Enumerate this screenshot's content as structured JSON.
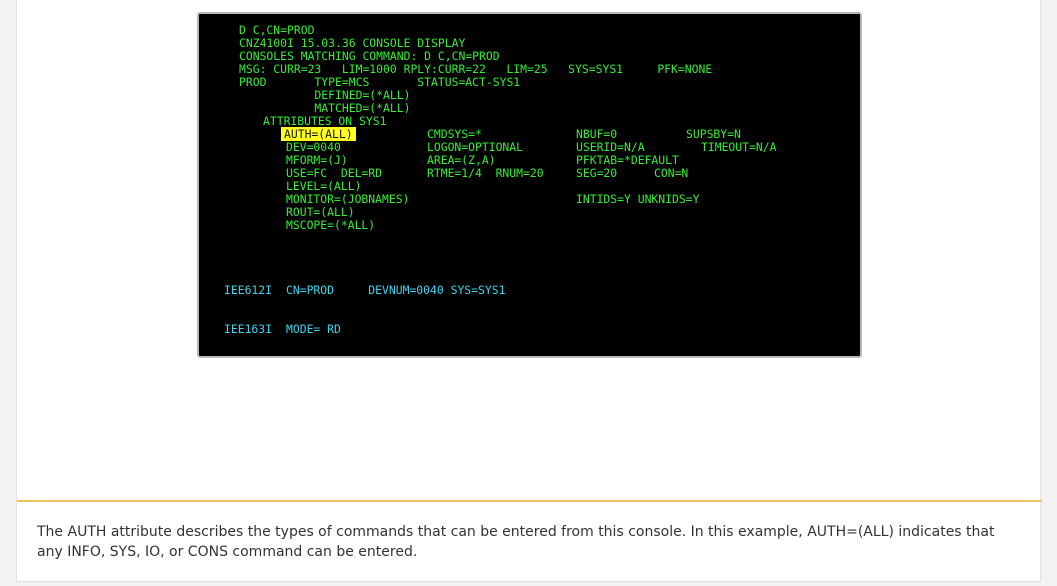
{
  "terminal": {
    "header": [
      "D C,CN=PROD",
      "CNZ4100I 15.03.36 CONSOLE DISPLAY",
      "CONSOLES MATCHING COMMAND: D C,CN=PROD",
      "MSG: CURR=23   LIM=1000 RPLY:CURR=22   LIM=25   SYS=SYS1     PFK=NONE",
      "PROD       TYPE=MCS       STATUS=ACT-SYS1",
      "           DEFINED=(*ALL)",
      "           MATCHED=(*ALL)"
    ],
    "attributes_title": "ATTRIBUTES ON SYS1",
    "auth_highlight": "AUTH=(ALL)",
    "col1": [
      "DEV=0040",
      "MFORM=(J)",
      "USE=FC  DEL=RD",
      "LEVEL=(ALL)",
      "MONITOR=(JOBNAMES)",
      "ROUT=(ALL)",
      "MSCOPE=(*ALL)"
    ],
    "col2": [
      "CMDSYS=*",
      "LOGON=OPTIONAL",
      "AREA=(Z,A)",
      "RTME=1/4  RNUM=20"
    ],
    "col3": [
      "NBUF=0",
      "USERID=N/A",
      "PFKTAB=*DEFAULT",
      "SEG=20",
      "",
      "INTIDS=Y UNKNIDS=Y"
    ],
    "col4": [
      "SUPSBY=N",
      "TIMEOUT=N/A",
      "",
      "CON=N"
    ],
    "msg1_id": "IEE612I",
    "msg1_text": "CN=PROD     DEVNUM=0040 SYS=SYS1",
    "msg2_id": "IEE163I",
    "msg2_text": "MODE= RD"
  },
  "caption": "The AUTH attribute describes the types of commands that can be entered from this console. In this example, AUTH=(ALL) indicates that any INFO, SYS, IO, or CONS command can be entered."
}
